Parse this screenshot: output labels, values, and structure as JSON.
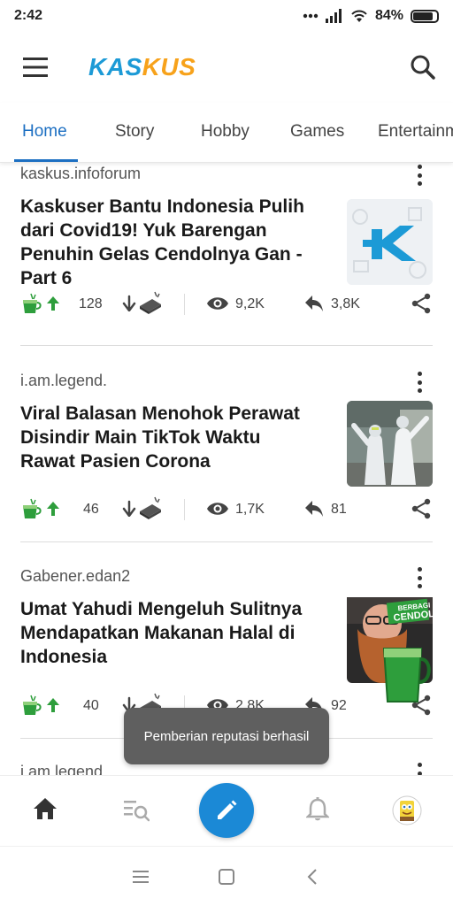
{
  "status_bar": {
    "time": "2:42",
    "battery": "84%"
  },
  "app": {
    "logo_left": "KAS",
    "logo_right": "KUS"
  },
  "tabs": [
    {
      "label": "Home",
      "active": true
    },
    {
      "label": "Story"
    },
    {
      "label": "Hobby"
    },
    {
      "label": "Games"
    },
    {
      "label": "Entertainment"
    }
  ],
  "posts": [
    {
      "author": "kaskus.infoforum",
      "title_lines": [
        "Kaskuser Bantu Indonesia Pulih",
        "dari Covid19! Yuk Barengan",
        "Penuhin Gelas Cendolnya Gan -",
        "Part 6"
      ],
      "reputation": "128",
      "views": "9,2K",
      "replies": "3,8K"
    },
    {
      "author": "i.am.legend.",
      "title_lines": [
        "Viral Balasan Menohok Perawat",
        "Disindir Main TikTok Waktu",
        "Rawat Pasien Corona"
      ],
      "reputation": "46",
      "views": "1,7K",
      "replies": "81"
    },
    {
      "author": "Gabener.edan2",
      "title_lines": [
        "Umat Yahudi Mengeluh Sulitnya",
        "Mendapatkan Makanan Halal di",
        "Indonesia"
      ],
      "reputation": "40",
      "views": "2,8K",
      "replies": "92",
      "badge_text_1": "BERBAGI",
      "badge_text_2": "CENDOL"
    },
    {
      "author": "i.am.legend."
    }
  ],
  "toast": "Pemberian reputasi berhasil",
  "colors": {
    "brand_blue": "#1c9ad6",
    "brand_orange": "#f7a21b",
    "tab_active": "#1c6fc2",
    "fab": "#1b89d6",
    "cendol_green": "#2e9e3c"
  }
}
